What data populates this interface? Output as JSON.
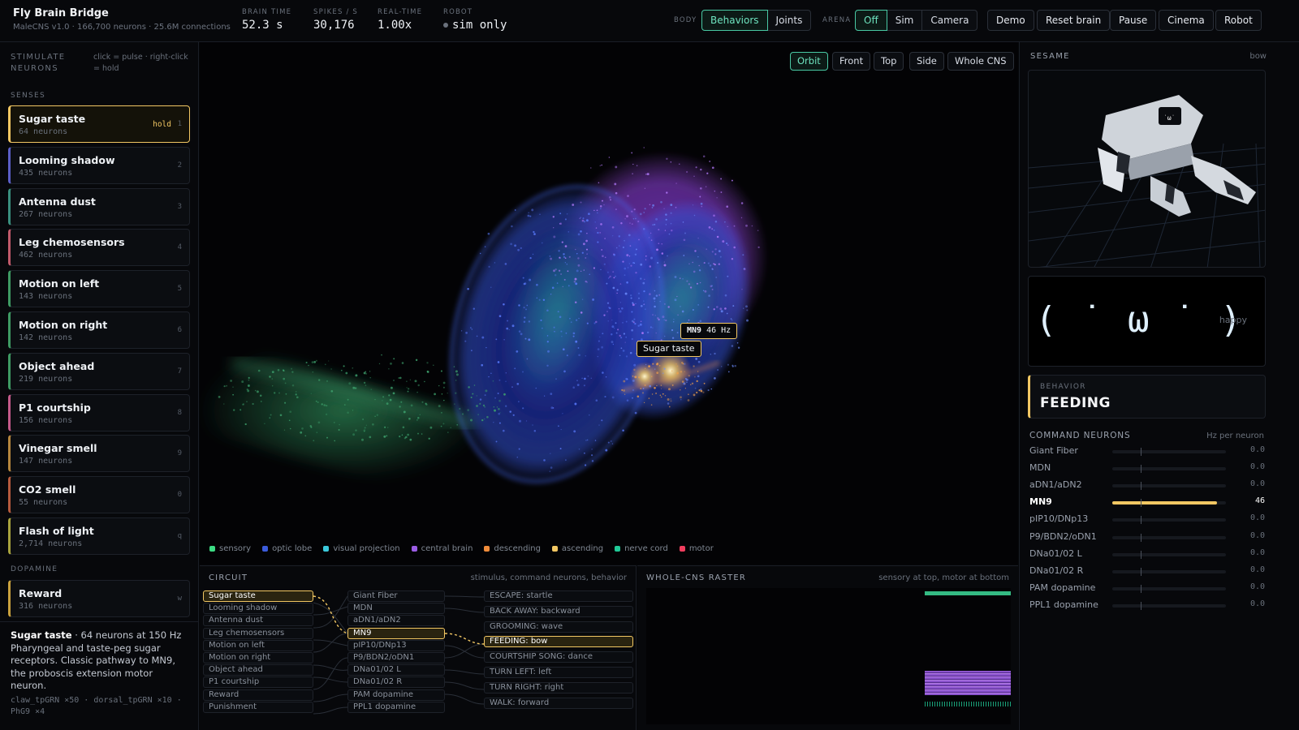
{
  "header": {
    "title": "Fly Brain Bridge",
    "subtitle": "MaleCNS v1.0 · 166,700 neurons · 25.6M connections",
    "stats": [
      {
        "label": "BRAIN TIME",
        "value": "52.3 s"
      },
      {
        "label": "SPIKES / S",
        "value": "30,176"
      },
      {
        "label": "REAL-TIME",
        "value": "1.00x"
      },
      {
        "label": "ROBOT",
        "value": "sim only"
      }
    ],
    "body_label": "BODY",
    "body_options": [
      "Behaviors",
      "Joints"
    ],
    "body_selected": "Behaviors",
    "arena_label": "ARENA",
    "arena_options": [
      "Off",
      "Sim",
      "Camera"
    ],
    "arena_selected": "Off",
    "actions": [
      "Demo",
      "Reset brain",
      "Pause",
      "Cinema",
      "Robot"
    ]
  },
  "left": {
    "title": "STIMULATE NEURONS",
    "hint": "click = pulse · right-click = hold",
    "senses_label": "SENSES",
    "senses": [
      {
        "name": "Sugar taste",
        "count": "64 neurons",
        "key": "1",
        "color": "#f2c763",
        "hold": "hold"
      },
      {
        "name": "Looming shadow",
        "count": "435 neurons",
        "key": "2",
        "color": "#5b5fc7"
      },
      {
        "name": "Antenna dust",
        "count": "267 neurons",
        "key": "3",
        "color": "#3a8f7e"
      },
      {
        "name": "Leg chemosensors",
        "count": "462 neurons",
        "key": "4",
        "color": "#c05a6a"
      },
      {
        "name": "Motion on left",
        "count": "143 neurons",
        "key": "5",
        "color": "#3e9a63"
      },
      {
        "name": "Motion on right",
        "count": "142 neurons",
        "key": "6",
        "color": "#3e9a63"
      },
      {
        "name": "Object ahead",
        "count": "219 neurons",
        "key": "7",
        "color": "#3e9a63"
      },
      {
        "name": "P1 courtship",
        "count": "156 neurons",
        "key": "8",
        "color": "#c45a8a"
      },
      {
        "name": "Vinegar smell",
        "count": "147 neurons",
        "key": "9",
        "color": "#b5863d"
      },
      {
        "name": "CO2 smell",
        "count": "55 neurons",
        "key": "0",
        "color": "#b55a3d"
      },
      {
        "name": "Flash of light",
        "count": "2,714 neurons",
        "key": "q",
        "color": "#a8a33d"
      }
    ],
    "dopamine_label": "DOPAMINE",
    "dopamine": [
      {
        "name": "Reward",
        "count": "316 neurons",
        "key": "w",
        "color": "#c9a13d"
      }
    ],
    "desc_name": "Sugar taste",
    "desc_detail": " · 64 neurons at 150 Hz",
    "desc_body": "Pharyngeal and taste-peg sugar receptors. Classic pathway to MN9, the proboscis extension motor neuron.",
    "desc_neurons": "claw_tpGRN ×50 · dorsal_tpGRN ×10 · PhG9 ×4"
  },
  "viewer": {
    "views": [
      "Orbit",
      "Front",
      "Top",
      "Side",
      "Whole CNS"
    ],
    "selected": "Orbit",
    "tooltip_neuron": "MN9",
    "tooltip_rate": "46 Hz",
    "tooltip_stim": "Sugar taste",
    "legend": [
      {
        "label": "sensory",
        "color": "#3ddc84"
      },
      {
        "label": "optic lobe",
        "color": "#3b5bdb"
      },
      {
        "label": "visual projection",
        "color": "#3bc9db"
      },
      {
        "label": "central brain",
        "color": "#9b5de5"
      },
      {
        "label": "descending",
        "color": "#f08c3a"
      },
      {
        "label": "ascending",
        "color": "#f2c763"
      },
      {
        "label": "nerve cord",
        "color": "#20c997"
      },
      {
        "label": "motor",
        "color": "#f03e5e"
      }
    ]
  },
  "circuit": {
    "title": "CIRCUIT",
    "subtitle": "stimulus, command neurons, behavior",
    "inputs": [
      "Sugar taste",
      "Looming shadow",
      "Antenna dust",
      "Leg chemosensors",
      "Motion on left",
      "Motion on right",
      "Object ahead",
      "P1 courtship",
      "Reward",
      "Punishment"
    ],
    "commands": [
      "Giant Fiber",
      "MDN",
      "aDN1/aDN2",
      "MN9",
      "pIP10/DNp13",
      "P9/BDN2/oDN1",
      "DNa01/02 L",
      "DNa01/02 R",
      "PAM dopamine",
      "PPL1 dopamine"
    ],
    "behaviors": [
      "ESCAPE: startle",
      "BACK AWAY: backward",
      "GROOMING: wave",
      "FEEDING: bow",
      "COURTSHIP SONG: dance",
      "TURN LEFT: left",
      "TURN RIGHT: right",
      "WALK: forward"
    ],
    "active_input": "Sugar taste",
    "active_command": "MN9",
    "active_behavior": "FEEDING: bow"
  },
  "raster": {
    "title": "WHOLE-CNS RASTER",
    "subtitle": "sensory at top, motor at bottom"
  },
  "right": {
    "robot_title": "SESAME",
    "robot_state": "bow",
    "face": "( ˙ ω ˙ )",
    "mood": "happy",
    "behavior_label": "BEHAVIOR",
    "behavior": "FEEDING",
    "cmd_title": "COMMAND NEURONS",
    "cmd_unit": "Hz per neuron",
    "cmd_max_hz": 50,
    "commands": [
      {
        "name": "Giant Fiber",
        "value": "0.0",
        "hz": 0
      },
      {
        "name": "MDN",
        "value": "0.0",
        "hz": 0
      },
      {
        "name": "aDN1/aDN2",
        "value": "0.0",
        "hz": 0
      },
      {
        "name": "MN9",
        "value": "46",
        "hz": 46
      },
      {
        "name": "pIP10/DNp13",
        "value": "0.0",
        "hz": 0
      },
      {
        "name": "P9/BDN2/oDN1",
        "value": "0.0",
        "hz": 0
      },
      {
        "name": "DNa01/02 L",
        "value": "0.0",
        "hz": 0
      },
      {
        "name": "DNa01/02 R",
        "value": "0.0",
        "hz": 0
      },
      {
        "name": "PAM dopamine",
        "value": "0.0",
        "hz": 0
      },
      {
        "name": "PPL1 dopamine",
        "value": "0.0",
        "hz": 0
      }
    ]
  }
}
